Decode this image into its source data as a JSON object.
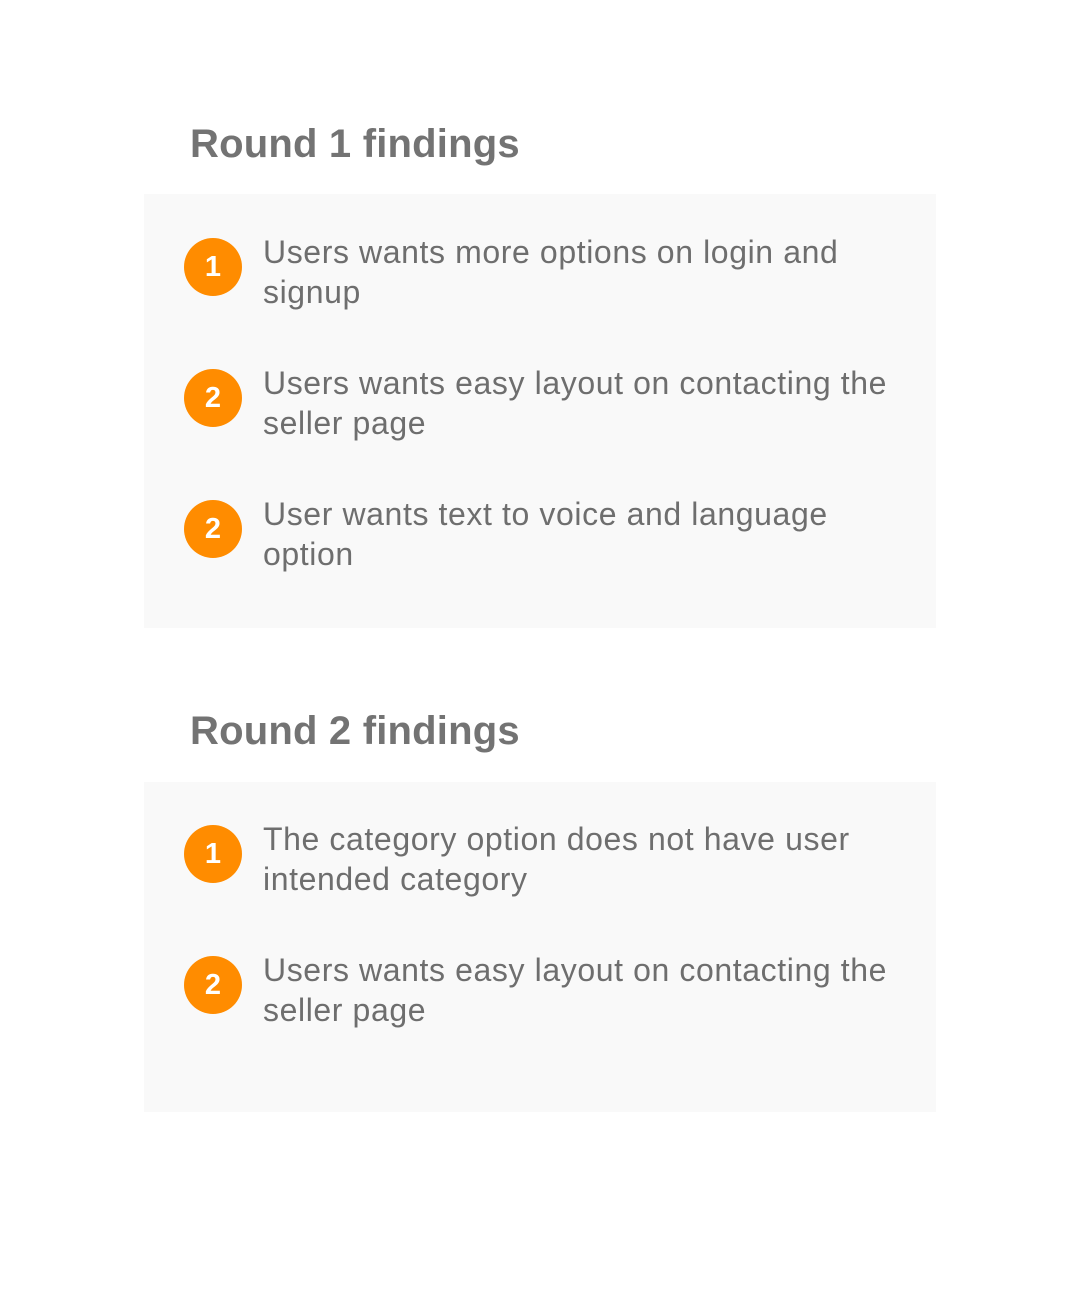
{
  "rounds": [
    {
      "title": "Round 1 findings",
      "findings": [
        {
          "number": "1",
          "text": "Users wants more options on login and signup"
        },
        {
          "number": "2",
          "text": "Users wants easy layout on contacting the seller page"
        },
        {
          "number": "2",
          "text": "User wants text to voice and language option"
        }
      ]
    },
    {
      "title": "Round 2 findings",
      "findings": [
        {
          "number": "1",
          "text": "The category option does not have user intended category"
        },
        {
          "number": "2",
          "text": "Users wants easy layout on contacting the seller page"
        }
      ]
    }
  ],
  "colors": {
    "badge": "#ff8c00",
    "panel": "#f9f9f9",
    "title": "#737373",
    "text": "#6e6e6e"
  }
}
